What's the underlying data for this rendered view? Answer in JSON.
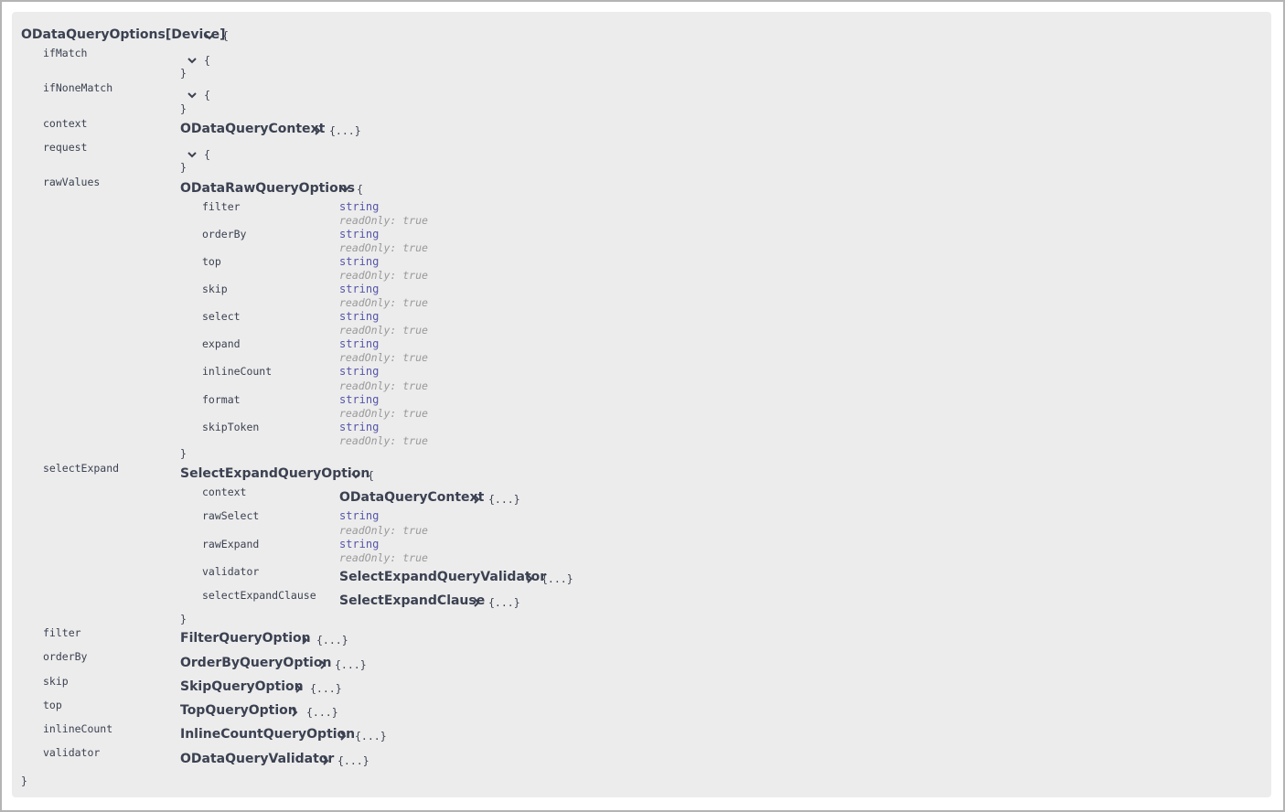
{
  "model": {
    "title": "ODataQueryOptions[Device]",
    "open_brace": "{",
    "close_brace": "}",
    "collapsed_brace": "{...}",
    "readonly_text": "readOnly: true",
    "string_type": "string"
  },
  "properties": {
    "ifMatch": "ifMatch",
    "ifNoneMatch": "ifNoneMatch",
    "context": "context",
    "request": "request",
    "rawValues": "rawValues",
    "selectExpand": "selectExpand",
    "filter": "filter",
    "orderBy": "orderBy",
    "skip": "skip",
    "top": "top",
    "inlineCount": "inlineCount",
    "validator": "validator"
  },
  "types": {
    "context": "ODataQueryContext",
    "rawValues": "ODataRawQueryOptions",
    "selectExpand": "SelectExpandQueryOption",
    "filter": "FilterQueryOption",
    "orderBy": "OrderByQueryOption",
    "skip": "SkipQueryOption",
    "top": "TopQueryOption",
    "inlineCount": "InlineCountQueryOption",
    "validator": "ODataQueryValidator"
  },
  "rawValues_props": [
    "filter",
    "orderBy",
    "top",
    "skip",
    "select",
    "expand",
    "inlineCount",
    "format",
    "skipToken"
  ],
  "selectExpand_props": {
    "context": "context",
    "context_type": "ODataQueryContext",
    "rawSelect": "rawSelect",
    "rawExpand": "rawExpand",
    "validator": "validator",
    "validator_type": "SelectExpandQueryValidator",
    "selectExpandClause": "selectExpandClause",
    "selectExpandClause_type": "SelectExpandClause"
  }
}
